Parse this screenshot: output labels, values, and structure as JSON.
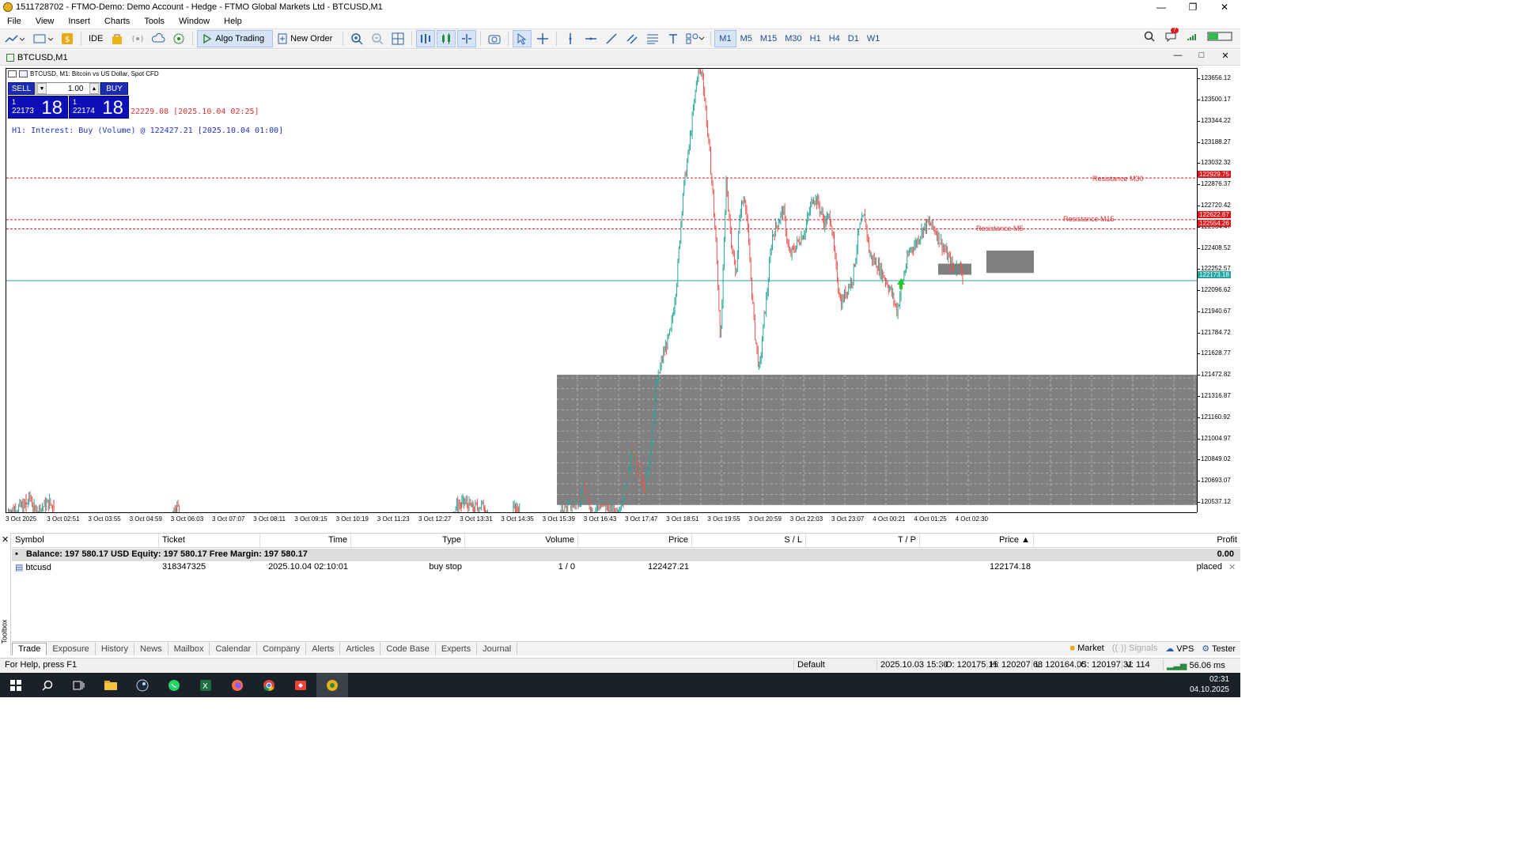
{
  "window": {
    "title": "1511728702 - FTMO-Demo: Demo Account - Hedge - FTMO Global Markets Ltd - BTCUSD,M1"
  },
  "menu": [
    "File",
    "View",
    "Insert",
    "Charts",
    "Tools",
    "Window",
    "Help"
  ],
  "toolbar": {
    "ide_label": "IDE",
    "algo_label": "Algo Trading",
    "new_order_label": "New Order",
    "timeframes": [
      "M1",
      "M5",
      "M15",
      "M30",
      "H1",
      "H4",
      "D1",
      "W1"
    ],
    "active_timeframe": "M1",
    "notification_count": "7"
  },
  "chart_window": {
    "title": "BTCUSD,M1"
  },
  "chart": {
    "symbol_header": "BTCUSD, M1: Bitcoin vs US Dollar, Spot CFD",
    "sell_label": "SELL",
    "buy_label": "BUY",
    "lot": "1.00",
    "sell_price_prefix": "1",
    "sell_price_main": "22173",
    "sell_price_big": "18",
    "buy_price_prefix": "1",
    "buy_price_main": "22174",
    "buy_price_big": "18",
    "info_red": "22229.08 [2025.10.04 02:25]",
    "info_blue": "H1: Interest: Buy (Volume) @ 122427.21 [2025.10.04 01:00]",
    "resistance_labels": [
      "Resistance M30",
      "Resistance M15",
      "Resistance M5"
    ],
    "level_badges": [
      "122929.75",
      "122622.67",
      "122554.26",
      "122173.18"
    ],
    "colors": {
      "bull": "#26a69a",
      "bear": "#ef5350",
      "resistance": "#e0181d",
      "bid_line": "#24a3a0",
      "zone": "#808080",
      "sell_buy_bg": "#1c2db5"
    }
  },
  "chart_data": {
    "type": "candlestick",
    "ylim": [
      120461,
      123734
    ],
    "price_ticks": [
      "123656.12",
      "123500.17",
      "123344.22",
      "123188.27",
      "123032.32",
      "122876.37",
      "122720.42",
      "122564.47",
      "122408.52",
      "122252.57",
      "122096.62",
      "121940.67",
      "121784.72",
      "121628.77",
      "121472.82",
      "121316.87",
      "121160.92",
      "121004.97",
      "120849.02",
      "120693.07",
      "120537.12"
    ],
    "time_ticks": [
      "3 Oct 2025",
      "3 Oct 02:51",
      "3 Oct 03:55",
      "3 Oct 04:59",
      "3 Oct 06:03",
      "3 Oct 07:07",
      "3 Oct 08:11",
      "3 Oct 09:15",
      "3 Oct 10:19",
      "3 Oct 11:23",
      "3 Oct 12:27",
      "3 Oct 13:31",
      "3 Oct 14:35",
      "3 Oct 15:39",
      "3 Oct 16:43",
      "3 Oct 17:47",
      "3 Oct 18:51",
      "3 Oct 19:55",
      "3 Oct 20:59",
      "3 Oct 22:03",
      "3 Oct 23:07",
      "4 Oct 00:21",
      "4 Oct 01:25",
      "4 Oct 02:30"
    ],
    "close_path": [
      [
        0,
        120470
      ],
      [
        25,
        120520
      ],
      [
        30,
        120580
      ],
      [
        36,
        120470
      ],
      [
        55,
        120540
      ],
      [
        60,
        120470
      ],
      [
        210,
        120470
      ],
      [
        215,
        120520
      ],
      [
        220,
        120470
      ],
      [
        565,
        120470
      ],
      [
        570,
        120520
      ],
      [
        580,
        120540
      ],
      [
        590,
        120490
      ],
      [
        600,
        120520
      ],
      [
        610,
        120470
      ],
      [
        640,
        120470
      ],
      [
        645,
        120500
      ],
      [
        650,
        120470
      ],
      [
        700,
        120470
      ],
      [
        720,
        120530
      ],
      [
        730,
        120620
      ],
      [
        740,
        120480
      ],
      [
        750,
        120520
      ],
      [
        770,
        120470
      ],
      [
        780,
        120560
      ],
      [
        790,
        120900
      ],
      [
        800,
        120780
      ],
      [
        808,
        120600
      ],
      [
        815,
        121000
      ],
      [
        822,
        121400
      ],
      [
        830,
        121620
      ],
      [
        840,
        121800
      ],
      [
        848,
        122200
      ],
      [
        855,
        122800
      ],
      [
        862,
        123100
      ],
      [
        868,
        123400
      ],
      [
        874,
        123720
      ],
      [
        880,
        123700
      ],
      [
        886,
        123300
      ],
      [
        892,
        122900
      ],
      [
        898,
        122350
      ],
      [
        903,
        121700
      ],
      [
        910,
        122900
      ],
      [
        916,
        122500
      ],
      [
        922,
        122200
      ],
      [
        928,
        122700
      ],
      [
        934,
        122800
      ],
      [
        940,
        122300
      ],
      [
        946,
        121800
      ],
      [
        952,
        121500
      ],
      [
        958,
        121900
      ],
      [
        962,
        122100
      ],
      [
        968,
        122500
      ],
      [
        975,
        122600
      ],
      [
        982,
        122700
      ],
      [
        990,
        122350
      ],
      [
        1000,
        122450
      ],
      [
        1010,
        122550
      ],
      [
        1020,
        122800
      ],
      [
        1026,
        122750
      ],
      [
        1034,
        122600
      ],
      [
        1042,
        122650
      ],
      [
        1048,
        122300
      ],
      [
        1055,
        122000
      ],
      [
        1062,
        122100
      ],
      [
        1070,
        122200
      ],
      [
        1078,
        122550
      ],
      [
        1085,
        122650
      ],
      [
        1092,
        122350
      ],
      [
        1100,
        122300
      ],
      [
        1110,
        122200
      ],
      [
        1118,
        122100
      ],
      [
        1126,
        121950
      ],
      [
        1134,
        122200
      ],
      [
        1142,
        122400
      ],
      [
        1150,
        122450
      ],
      [
        1158,
        122550
      ],
      [
        1166,
        122600
      ],
      [
        1174,
        122550
      ],
      [
        1182,
        122450
      ],
      [
        1190,
        122350
      ],
      [
        1198,
        122250
      ],
      [
        1204,
        122300
      ],
      [
        1210,
        122180
      ]
    ],
    "resistances": [
      {
        "name": "Resistance M30",
        "price": 122929.75
      },
      {
        "name": "Resistance M15",
        "price": 122622.67
      },
      {
        "name": "Resistance M5",
        "price": 122554.26
      }
    ],
    "bid": 122173.18,
    "demand_zone": {
      "price_top": 121480,
      "price_bottom": 120520,
      "start": "3 Oct 15:10"
    },
    "small_zones": [
      {
        "price_top": 122395,
        "price_bottom": 122230
      },
      {
        "price_top": 122275,
        "price_bottom": 122235
      }
    ]
  },
  "trade": {
    "columns": [
      "Symbol",
      "Ticket",
      "Time",
      "Type",
      "Volume",
      "Price",
      "S / L",
      "T / P",
      "Price",
      "Profit"
    ],
    "balance_line": "Balance: 197 580.17 USD  Equity: 197 580.17  Free Margin: 197 580.17",
    "balance_profit": "0.00",
    "orders": [
      {
        "symbol": "btcusd",
        "ticket": "318347325",
        "time": "2025.10.04 02:10:01",
        "type": "buy stop",
        "volume": "1 / 0",
        "price": "122427.21",
        "sl": "",
        "tp": "",
        "cur_price": "122174.18",
        "profit": "placed"
      }
    ]
  },
  "tabs": [
    "Trade",
    "Exposure",
    "History",
    "News",
    "Mailbox",
    "Calendar",
    "Company",
    "Alerts",
    "Articles",
    "Code Base",
    "Experts",
    "Journal"
  ],
  "tabs_right": [
    "Market",
    "Signals",
    "VPS",
    "Tester"
  ],
  "toolbox_label": "Toolbox",
  "status": {
    "help": "For Help, press F1",
    "profile": "Default",
    "datetime": "2025.10.03 15:30",
    "open": "O: 120175.15",
    "high": "H: 120207.68",
    "low": "L: 120164.05",
    "close": "C: 120197.31",
    "volume": "V: 114",
    "ping": "56.06 ms"
  },
  "taskbar": {
    "time": "02:31",
    "date": "04.10.2025"
  }
}
